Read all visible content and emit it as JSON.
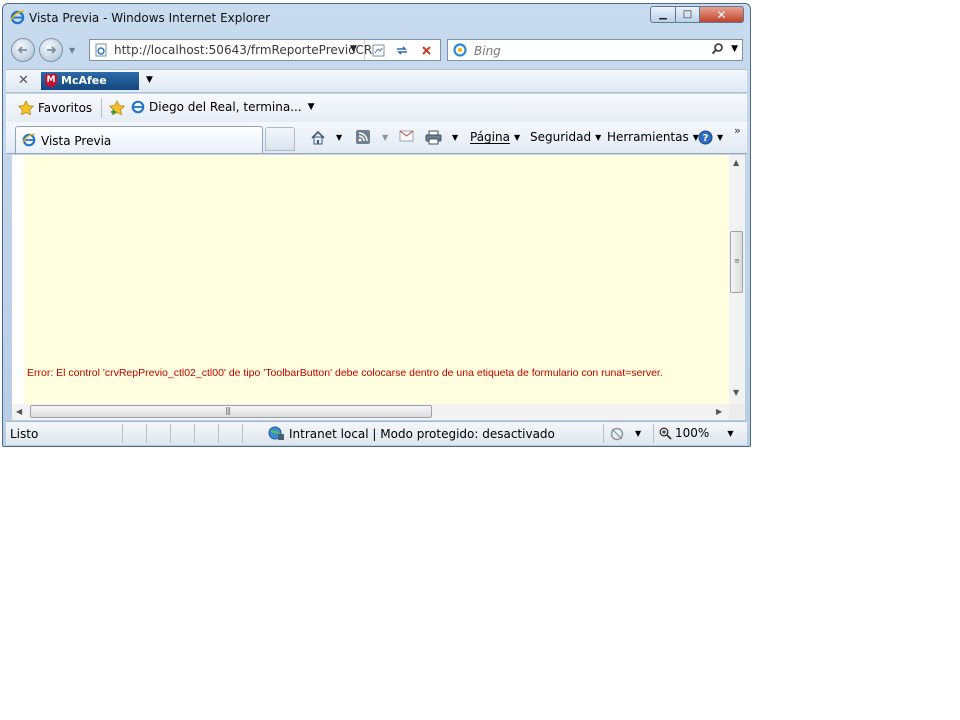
{
  "window": {
    "title": "Vista Previa - Windows Internet Explorer",
    "minimize_glyph": "▁",
    "maximize_glyph": "□",
    "close_glyph": "✕"
  },
  "navigation": {
    "back_icon": "back-arrow-icon",
    "forward_icon": "forward-arrow-icon",
    "address_value": "http://localhost:50643/frmReportePrevioCR",
    "search_placeholder": "Bing"
  },
  "mcafee_toolbar": {
    "close_glyph": "✕",
    "brand_label": "McAfee",
    "shield_letter": "M"
  },
  "favorites_bar": {
    "favorites_label": "Favoritos",
    "link_label": "Diego del Real, termina..."
  },
  "tab": {
    "label": "Vista Previa"
  },
  "command_bar": {
    "page_label": "Página",
    "safety_label": "Seguridad",
    "tools_label": "Herramientas",
    "overflow_glyph": "»"
  },
  "content": {
    "background_color": "#ffffe0",
    "error_message": "Error: El control 'crvRepPrevio_ctl02_ctl00' de tipo 'ToolbarButton' debe colocarse dentro de una etiqueta de formulario con runat=server.",
    "error_color": "#c00000"
  },
  "status_bar": {
    "status_text": "Listo",
    "zone_text": "Intranet local | Modo protegido: desactivado",
    "zoom_text": "100%"
  }
}
